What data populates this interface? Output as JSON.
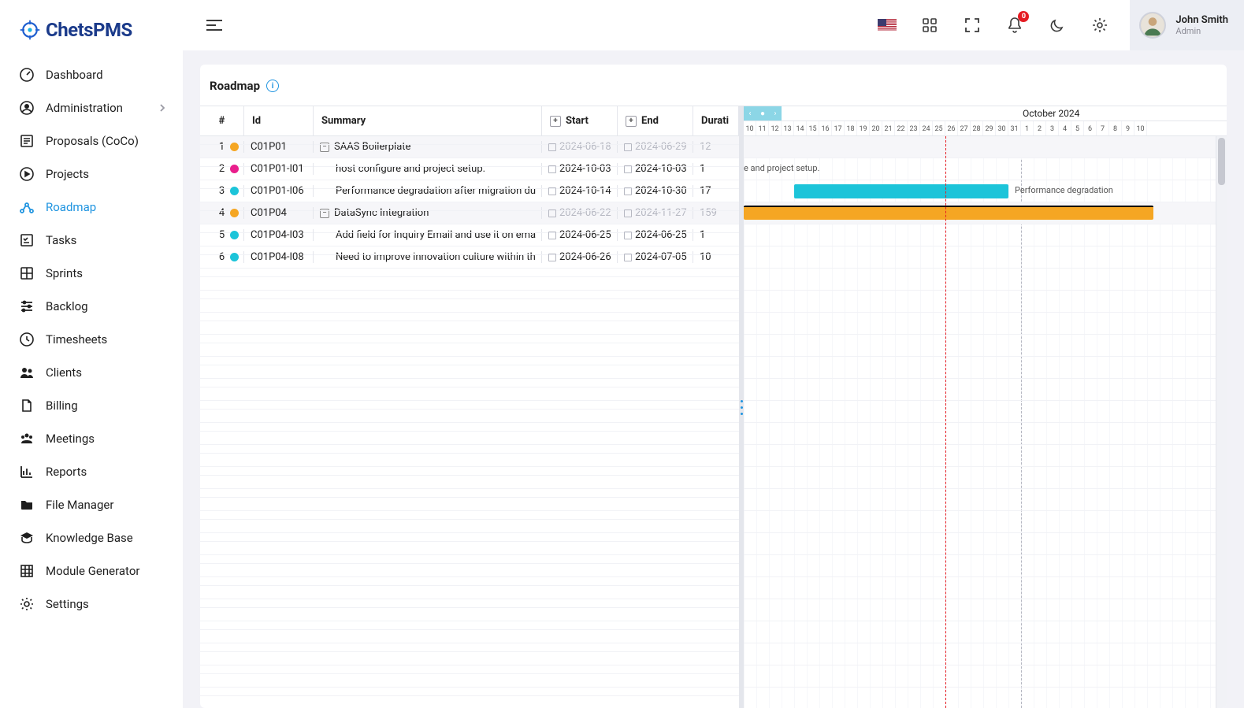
{
  "brand": {
    "name": "ChetsPMS"
  },
  "sidebar": {
    "items": [
      {
        "label": "Dashboard",
        "icon": "gauge-icon"
      },
      {
        "label": "Administration",
        "icon": "user-circle-icon",
        "hasSubmenu": true
      },
      {
        "label": "Proposals (CoCo)",
        "icon": "proposal-icon"
      },
      {
        "label": "Projects",
        "icon": "play-circle-icon"
      },
      {
        "label": "Roadmap",
        "icon": "roadmap-icon",
        "active": true
      },
      {
        "label": "Tasks",
        "icon": "checklist-icon"
      },
      {
        "label": "Sprints",
        "icon": "board-icon"
      },
      {
        "label": "Backlog",
        "icon": "sliders-icon"
      },
      {
        "label": "Timesheets",
        "icon": "clock-icon"
      },
      {
        "label": "Clients",
        "icon": "people-icon"
      },
      {
        "label": "Billing",
        "icon": "file-icon"
      },
      {
        "label": "Meetings",
        "icon": "group-icon"
      },
      {
        "label": "Reports",
        "icon": "chart-icon"
      },
      {
        "label": "File Manager",
        "icon": "folder-icon"
      },
      {
        "label": "Knowledge Base",
        "icon": "graduation-icon"
      },
      {
        "label": "Module Generator",
        "icon": "grid-icon"
      },
      {
        "label": "Settings",
        "icon": "gear-icon"
      }
    ]
  },
  "topbar": {
    "notifications": "0",
    "user": {
      "name": "John Smith",
      "role": "Admin"
    }
  },
  "page": {
    "title": "Roadmap"
  },
  "gantt": {
    "monthLabel": "October 2024",
    "days": [
      "10",
      "11",
      "12",
      "13",
      "14",
      "15",
      "16",
      "17",
      "18",
      "19",
      "20",
      "21",
      "22",
      "23",
      "24",
      "25",
      "26",
      "27",
      "28",
      "29",
      "30",
      "31",
      "1",
      "2",
      "3",
      "4",
      "5",
      "6",
      "7",
      "8",
      "9",
      "10"
    ],
    "columns": {
      "num": "#",
      "id": "Id",
      "summary": "Summary",
      "start": "Start",
      "end": "End",
      "duration": "Durati"
    },
    "rows": [
      {
        "num": "1",
        "id": "C01P01",
        "dot": "#f5a623",
        "summary": "SAAS Boilerplate",
        "start": "2024-06-18",
        "end": "2024-06-29",
        "duration": "12",
        "parent": true,
        "muted": true
      },
      {
        "num": "2",
        "id": "C01P01-I01",
        "dot": "#e91e8c",
        "summary": "host configure and project setup.",
        "start": "2024-10-03",
        "end": "2024-10-03",
        "duration": "1",
        "indent": 1
      },
      {
        "num": "3",
        "id": "C01P01-I06",
        "dot": "#1cc4d9",
        "summary": "Performance degradation after migration du",
        "start": "2024-10-14",
        "end": "2024-10-30",
        "duration": "17",
        "indent": 1
      },
      {
        "num": "4",
        "id": "C01P04",
        "dot": "#f5a623",
        "summary": "DataSync Integration",
        "start": "2024-06-22",
        "end": "2024-11-27",
        "duration": "159",
        "parent": true,
        "muted": true
      },
      {
        "num": "5",
        "id": "C01P04-I03",
        "dot": "#1cc4d9",
        "summary": "Add field for Inquiry Email and use it on ema",
        "start": "2024-06-25",
        "end": "2024-06-25",
        "duration": "1",
        "indent": 1
      },
      {
        "num": "6",
        "id": "C01P04-I08",
        "dot": "#1cc4d9",
        "summary": "Need to improve innovation culture within th",
        "start": "2024-06-26",
        "end": "2024-07-05",
        "duration": "10",
        "indent": 1
      }
    ],
    "bars": {
      "row2_label": "e and project setup.",
      "row3_label": "Performance degradation"
    }
  }
}
